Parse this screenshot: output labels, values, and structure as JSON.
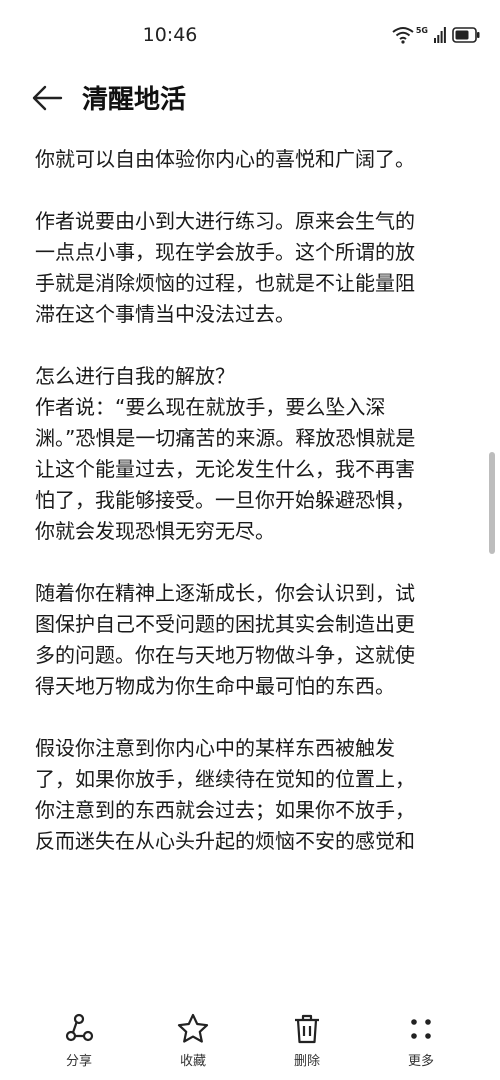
{
  "status": {
    "time": "10:46",
    "network": "5G"
  },
  "header": {
    "title": "清醒地活"
  },
  "content": {
    "paragraphs": [
      {
        "lines": [
          "你就可以自由体验你内心的喜悦和广阔了。"
        ]
      },
      {
        "lines": [
          "作者说要由小到大进行练习。原来会生气的",
          "一点点小事，现在学会放手。这个所谓的放",
          "手就是消除烦恼的过程，也就是不让能量阻",
          "滞在这个事情当中没法过去。"
        ]
      },
      {
        "lines": [
          "怎么进行自我的解放？",
          "作者说：“要么现在就放手，要么坠入深",
          "渊。”恐惧是一切痛苦的来源。释放恐惧就是",
          "让这个能量过去，无论发生什么，我不再害",
          "怕了，我能够接受。一旦你开始躲避恐惧，",
          "你就会发现恐惧无穷无尽。"
        ]
      },
      {
        "lines": [
          "随着你在精神上逐渐成长，你会认识到，试",
          "图保护自己不受问题的困扰其实会制造出更",
          "多的问题。你在与天地万物做斗争，这就使",
          "得天地万物成为你生命中最可怕的东西。"
        ]
      },
      {
        "lines": [
          "假设你注意到你内心中的某样东西被触发",
          "了，如果你放手，继续待在觉知的位置上，",
          "你注意到的东西就会过去；如果你不放手，",
          "反而迷失在从心头升起的烦恼不安的感觉和"
        ]
      }
    ]
  },
  "toolbar": {
    "share": "分享",
    "favorite": "收藏",
    "delete": "删除",
    "more": "更多"
  }
}
